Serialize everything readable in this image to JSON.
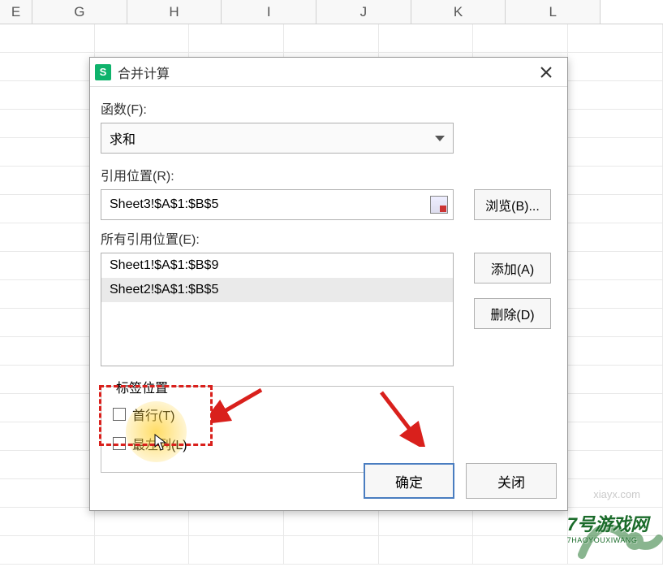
{
  "spreadsheet": {
    "columns": [
      "E",
      "G",
      "H",
      "I",
      "J",
      "K",
      "L"
    ]
  },
  "dialog": {
    "app_icon_letter": "S",
    "title": "合并计算",
    "function_label": "函数(F):",
    "function_value": "求和",
    "ref_label": "引用位置(R):",
    "ref_value": "Sheet3!$A$1:$B$5",
    "browse_label": "浏览(B)...",
    "all_refs_label": "所有引用位置(E):",
    "refs_list": [
      "Sheet1!$A$1:$B$9",
      "Sheet2!$A$1:$B$5"
    ],
    "add_label": "添加(A)",
    "delete_label": "删除(D)",
    "label_pos_legend": "标签位置",
    "top_row_label": "首行(T)",
    "left_col_label": "最左列(L)",
    "ok_label": "确定",
    "close_label": "关闭"
  },
  "watermarks": {
    "site": "xiayx.com",
    "logo_main": "7号游戏网",
    "logo_sub": "7HAOYOUXIWANG"
  }
}
